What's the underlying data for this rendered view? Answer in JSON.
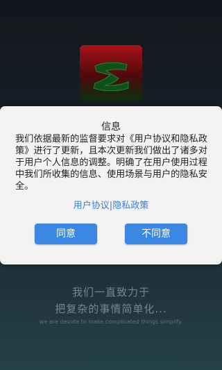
{
  "background": {
    "slogan_line1": "我们一直致力于",
    "slogan_line2": "把复杂的事情简单化...",
    "slogan_en": "we are devote to make complicated things simplify."
  },
  "app_icon": {
    "icon": "app-logo-icon"
  },
  "dialog": {
    "title": "信息",
    "message": "我们依据最新的监督要求对《用户协议和隐私政策》进行了更新，且本次更新我们做出了诸多对于用户个人信息的调整。明确了在用户使用过程中我们所收集的信息、使用场景与用户的隐私安全。",
    "link_user_agreement": "用户协议",
    "link_separator": "|",
    "link_privacy_policy": "隐私政策",
    "agree_label": "同意",
    "disagree_label": "不同意"
  },
  "colors": {
    "accent": "#3a88e3",
    "link": "#3a7dd8"
  }
}
